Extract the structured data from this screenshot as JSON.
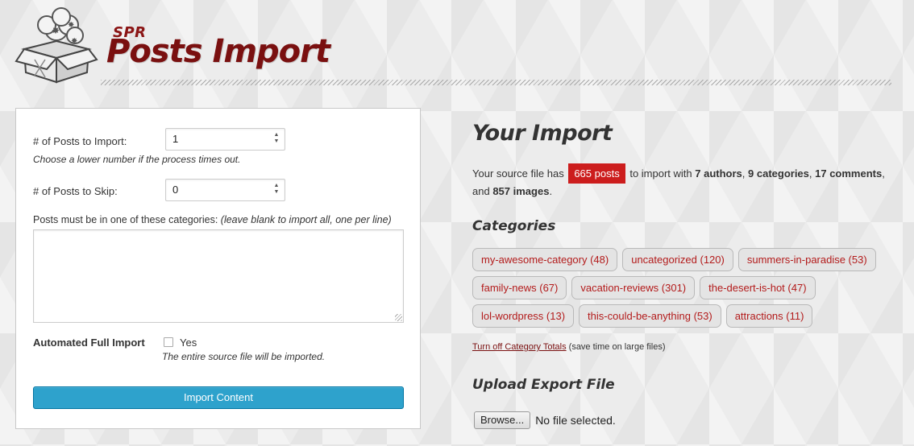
{
  "header": {
    "brand_small": "SPR",
    "brand_title": "Posts Import"
  },
  "form": {
    "posts_to_import_label": "# of Posts to Import:",
    "posts_to_import_value": "1",
    "posts_to_import_hint": "Choose a lower number if the process times out.",
    "posts_to_skip_label": "# of Posts to Skip:",
    "posts_to_skip_value": "0",
    "categories_label": "Posts must be in one of these categories:",
    "categories_hint": "(leave blank to import all, one per line)",
    "categories_value": "",
    "automated_label": "Automated Full Import",
    "automated_option": "Yes",
    "automated_checked": false,
    "automated_hint": "The entire source file will be imported.",
    "import_button": "Import Content"
  },
  "summary": {
    "heading": "Your Import",
    "prefix": "Your source file has",
    "posts": "665 posts",
    "mid": "to import with",
    "authors": "7 authors",
    "categories": "9 categories",
    "comments": "17 comments",
    "and": "and",
    "images": "857 images"
  },
  "categories_section": {
    "heading": "Categories",
    "rows": [
      [
        "my-awesome-category (48)",
        "uncategorized (120)",
        "summers-in-paradise (53)"
      ],
      [
        "family-news (67)",
        "vacation-reviews (301)",
        "the-desert-is-hot (47)"
      ],
      [
        "lol-wordpress (13)",
        "this-could-be-anything (53)",
        "attractions (11)"
      ]
    ],
    "totals_link": "Turn off Category Totals",
    "totals_note": "(save time on large files)"
  },
  "upload": {
    "heading": "Upload Export File",
    "browse_button": "Browse...",
    "file_status": "No file selected."
  },
  "colors": {
    "brand": "#7a1010",
    "badge": "#cc1d1d",
    "button": "#2ea2cc",
    "category_text": "#b31b1b"
  }
}
